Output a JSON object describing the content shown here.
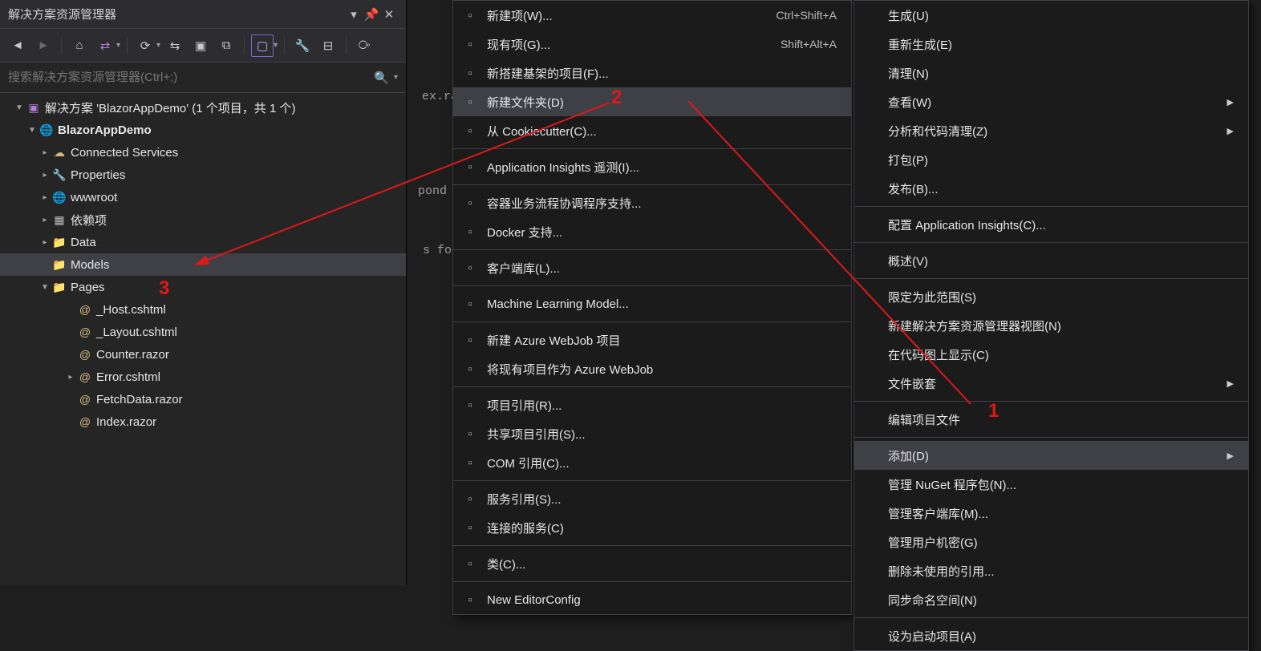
{
  "panel": {
    "title": "解决方案资源管理器",
    "search_placeholder": "搜索解决方案资源管理器(Ctrl+;)",
    "solution_line": "解决方案 'BlazorAppDemo' (1 个项目，共 1 个)"
  },
  "tree": {
    "project": "BlazorAppDemo",
    "items": [
      "Connected Services",
      "Properties",
      "wwwroot",
      "依赖项",
      "Data",
      "Models",
      "Pages"
    ],
    "pages": [
      "_Host.cshtml",
      "_Layout.cshtml",
      "Counter.razor",
      "Error.cshtml",
      "FetchData.razor",
      "Index.razor"
    ]
  },
  "submenu": {
    "items": [
      {
        "label": "新建项(W)...",
        "shortcut": "Ctrl+Shift+A"
      },
      {
        "label": "现有项(G)...",
        "shortcut": "Shift+Alt+A"
      },
      {
        "label": "新搭建基架的项目(F)...",
        "shortcut": ""
      },
      {
        "label": "新建文件夹(D)",
        "shortcut": "",
        "highlight": true
      },
      {
        "label": "从 Cookiecutter(C)...",
        "shortcut": ""
      },
      {
        "sep": true
      },
      {
        "label": "Application Insights 遥测(I)...",
        "shortcut": ""
      },
      {
        "sep": true
      },
      {
        "label": "容器业务流程协调程序支持...",
        "shortcut": ""
      },
      {
        "label": "Docker 支持...",
        "shortcut": ""
      },
      {
        "sep": true
      },
      {
        "label": "客户端库(L)...",
        "shortcut": ""
      },
      {
        "sep": true
      },
      {
        "label": "Machine Learning Model...",
        "shortcut": ""
      },
      {
        "sep": true
      },
      {
        "label": "新建 Azure WebJob 项目",
        "shortcut": ""
      },
      {
        "label": "将现有项目作为 Azure WebJob",
        "shortcut": ""
      },
      {
        "sep": true
      },
      {
        "label": "项目引用(R)...",
        "shortcut": ""
      },
      {
        "label": "共享项目引用(S)...",
        "shortcut": ""
      },
      {
        "label": "COM 引用(C)...",
        "shortcut": ""
      },
      {
        "sep": true
      },
      {
        "label": "服务引用(S)...",
        "shortcut": ""
      },
      {
        "label": "连接的服务(C)",
        "shortcut": ""
      },
      {
        "sep": true
      },
      {
        "label": "类(C)...",
        "shortcut": ""
      },
      {
        "sep": true
      },
      {
        "label": "New EditorConfig",
        "shortcut": ""
      }
    ]
  },
  "mainmenu": {
    "items": [
      {
        "label": "生成(U)"
      },
      {
        "label": "重新生成(E)"
      },
      {
        "label": "清理(N)"
      },
      {
        "label": "查看(W)",
        "arrow": true
      },
      {
        "label": "分析和代码清理(Z)",
        "arrow": true
      },
      {
        "label": "打包(P)"
      },
      {
        "label": "发布(B)..."
      },
      {
        "sep": true
      },
      {
        "label": "配置 Application Insights(C)..."
      },
      {
        "sep": true
      },
      {
        "label": "概述(V)"
      },
      {
        "sep": true
      },
      {
        "label": "限定为此范围(S)"
      },
      {
        "label": "新建解决方案资源管理器视图(N)"
      },
      {
        "label": "在代码图上显示(C)"
      },
      {
        "label": "文件嵌套",
        "arrow": true
      },
      {
        "sep": true
      },
      {
        "label": "编辑项目文件"
      },
      {
        "sep": true
      },
      {
        "label": "添加(D)",
        "arrow": true,
        "highlight": true
      },
      {
        "label": "管理 NuGet 程序包(N)..."
      },
      {
        "label": "管理客户端库(M)..."
      },
      {
        "label": "管理用户机密(G)"
      },
      {
        "label": "删除未使用的引用..."
      },
      {
        "label": "同步命名空间(N)"
      },
      {
        "sep": true
      },
      {
        "label": "设为启动项目(A)"
      }
    ]
  },
  "annotations": {
    "a1": "1",
    "a2": "2",
    "a3": "3"
  },
  "bg": {
    "t1": "ex.ra",
    "t2": "pond",
    "t3": "s fo"
  }
}
